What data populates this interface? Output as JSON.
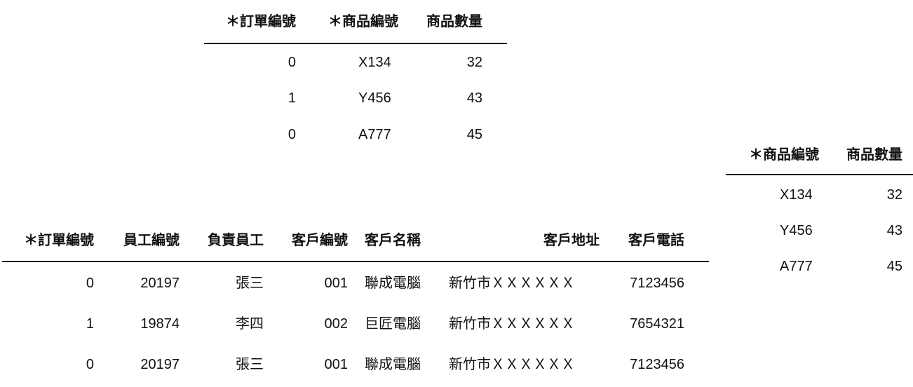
{
  "order_items_table": {
    "headers": [
      "＊訂單編號",
      "＊商品編號",
      "商品數量"
    ],
    "rows": [
      [
        "0",
        "X134",
        "32"
      ],
      [
        "1",
        "Y456",
        "43"
      ],
      [
        "0",
        "A777",
        "45"
      ]
    ]
  },
  "product_quantity_table": {
    "headers": [
      "＊商品編號",
      "商品數量"
    ],
    "rows": [
      [
        "X134",
        "32"
      ],
      [
        "Y456",
        "43"
      ],
      [
        "A777",
        "45"
      ]
    ]
  },
  "orders_table": {
    "headers": [
      "＊訂單編號",
      "員工編號",
      "負責員工",
      "客戶編號",
      "客戶名稱",
      "客戶地址",
      "客戶電話"
    ],
    "rows": [
      [
        "0",
        "20197",
        "張三",
        "001",
        "聯成電腦",
        "新竹市ＸＸＸＸＸＸ",
        "7123456"
      ],
      [
        "1",
        "19874",
        "李四",
        "002",
        "巨匠電腦",
        "新竹市ＸＸＸＸＸＸ",
        "7654321"
      ],
      [
        "0",
        "20197",
        "張三",
        "001",
        "聯成電腦",
        "新竹市ＸＸＸＸＸＸ",
        "7123456"
      ]
    ]
  }
}
